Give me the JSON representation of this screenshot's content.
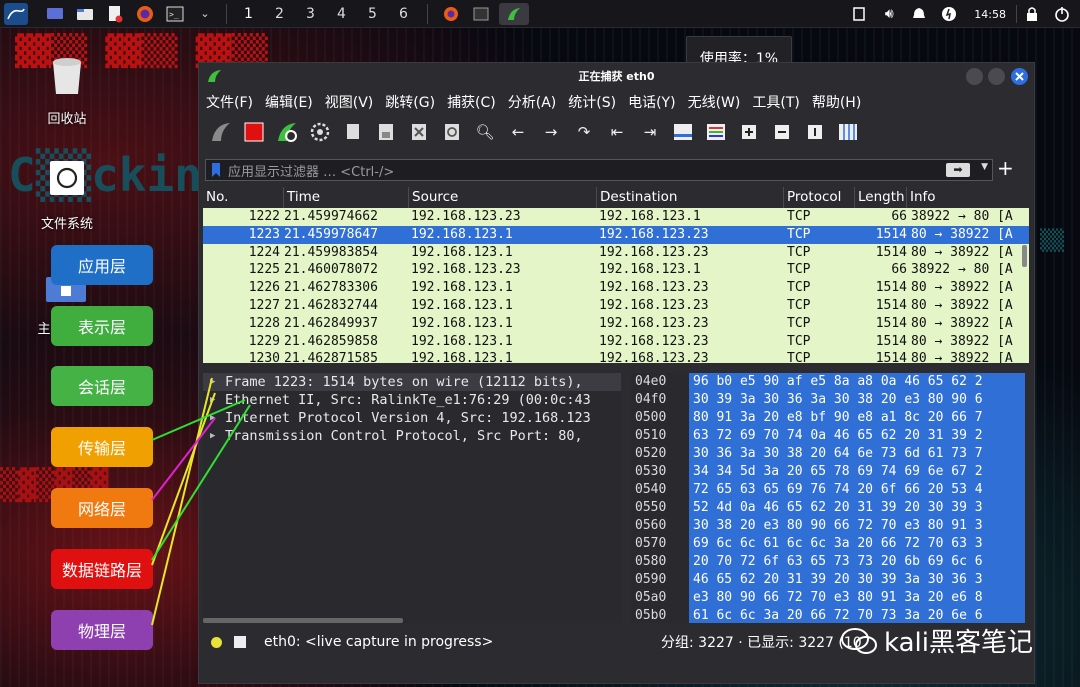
{
  "topbar": {
    "workspaces": [
      "1",
      "2",
      "3",
      "4",
      "5",
      "6"
    ],
    "clock": "14:58"
  },
  "usage_popup": "使用率：1%",
  "desktop": {
    "trash_label": "回收站",
    "filesystem_label": "文件系统",
    "home_label": "主"
  },
  "osi_layers": [
    {
      "label": "应用层",
      "color": "#1f6fc7"
    },
    {
      "label": "表示层",
      "color": "#3fae3f"
    },
    {
      "label": "会话层",
      "color": "#44b244"
    },
    {
      "label": "传输层",
      "color": "#f0a000"
    },
    {
      "label": "网络层",
      "color": "#f07a10"
    },
    {
      "label": "数据链路层",
      "color": "#e01010"
    },
    {
      "label": "物理层",
      "color": "#8e3fb0"
    }
  ],
  "window": {
    "title": "正在捕获 eth0",
    "menu": [
      "文件(F)",
      "编辑(E)",
      "视图(V)",
      "跳转(G)",
      "捕获(C)",
      "分析(A)",
      "统计(S)",
      "电话(Y)",
      "无线(W)",
      "工具(T)",
      "帮助(H)"
    ],
    "filter_placeholder": "应用显示过滤器 … <Ctrl-/>",
    "columns": [
      "No.",
      "Time",
      "Source",
      "Destination",
      "Protocol",
      "Length",
      "Info"
    ],
    "packets": [
      {
        "no": "1222",
        "time": "21.459974662",
        "src": "192.168.123.23",
        "dst": "192.168.123.1",
        "proto": "TCP",
        "len": "66",
        "info": "38922 → 80 [A"
      },
      {
        "no": "1223",
        "time": "21.459978647",
        "src": "192.168.123.1",
        "dst": "192.168.123.23",
        "proto": "TCP",
        "len": "1514",
        "info": "80 → 38922 [A"
      },
      {
        "no": "1224",
        "time": "21.459983854",
        "src": "192.168.123.1",
        "dst": "192.168.123.23",
        "proto": "TCP",
        "len": "1514",
        "info": "80 → 38922 [A"
      },
      {
        "no": "1225",
        "time": "21.460078072",
        "src": "192.168.123.23",
        "dst": "192.168.123.1",
        "proto": "TCP",
        "len": "66",
        "info": "38922 → 80 [A"
      },
      {
        "no": "1226",
        "time": "21.462783306",
        "src": "192.168.123.1",
        "dst": "192.168.123.23",
        "proto": "TCP",
        "len": "1514",
        "info": "80 → 38922 [A"
      },
      {
        "no": "1227",
        "time": "21.462832744",
        "src": "192.168.123.1",
        "dst": "192.168.123.23",
        "proto": "TCP",
        "len": "1514",
        "info": "80 → 38922 [A"
      },
      {
        "no": "1228",
        "time": "21.462849937",
        "src": "192.168.123.1",
        "dst": "192.168.123.23",
        "proto": "TCP",
        "len": "1514",
        "info": "80 → 38922 [A"
      },
      {
        "no": "1229",
        "time": "21.462859858",
        "src": "192.168.123.1",
        "dst": "192.168.123.23",
        "proto": "TCP",
        "len": "1514",
        "info": "80 → 38922 [A"
      },
      {
        "no": "1230",
        "time": "21.462871585",
        "src": "192.168.123.1",
        "dst": "192.168.123.23",
        "proto": "TCP",
        "len": "1514",
        "info": "80 → 38922 [A"
      }
    ],
    "details": [
      "Frame 1223: 1514 bytes on wire (12112 bits),",
      "Ethernet II, Src: RalinkTe_e1:76:29 (00:0c:43",
      "Internet Protocol Version 4, Src: 192.168.123",
      "Transmission Control Protocol, Src Port: 80,"
    ],
    "hex": [
      {
        "off": "04e0",
        "bytes": "96 b0 e5 90 af e5 8a a8  0a 46 65 62 2"
      },
      {
        "off": "04f0",
        "bytes": "30 39 3a 30 36 3a 30 38  20 e3 80 90 6"
      },
      {
        "off": "0500",
        "bytes": "80 91 3a 20 e8 bf 90 e8  a1 8c 20 66 7"
      },
      {
        "off": "0510",
        "bytes": "63 72 69 70 74 0a 46 65  62 20 31 39 2"
      },
      {
        "off": "0520",
        "bytes": "30 36 3a 30 38 20 64 6e  73 6d 61 73 7"
      },
      {
        "off": "0530",
        "bytes": "34 34 5d 3a 20 65 78 69  74 69 6e 67 2"
      },
      {
        "off": "0540",
        "bytes": "72 65 63 65 69 76 74 20  6f 66 20 53 4"
      },
      {
        "off": "0550",
        "bytes": "52 4d 0a 46 65 62 20 31  39 20 30 39 3"
      },
      {
        "off": "0560",
        "bytes": "30 38 20 e3 80 90 66 72  70 e3 80 91 3"
      },
      {
        "off": "0570",
        "bytes": "69 6c 6c 61 6c 6c 3a 20  66 72 70 63 3"
      },
      {
        "off": "0580",
        "bytes": "20 70 72 6f 63 65 73 73  20 6b 69 6c 6"
      },
      {
        "off": "0590",
        "bytes": "46 65 62 20 31 39 20 30  39 3a 30 36 3"
      },
      {
        "off": "05a0",
        "bytes": "e3 80 90 66 72 70 e3 80  91 3a 20 e6 8"
      },
      {
        "off": "05b0",
        "bytes": "61 6c 6c 3a 20 66 72 70  73 3a 20 6e 6"
      },
      {
        "off": "05c0",
        "bytes": "6f 63 65 73 73 20 6b 69  6c 6c 65 64 0"
      }
    ],
    "status_capture": "eth0: <live capture in progress>",
    "status_counts": "分组: 3227 · 已显示: 3227 (10"
  },
  "watermark": "kali黑客笔记"
}
